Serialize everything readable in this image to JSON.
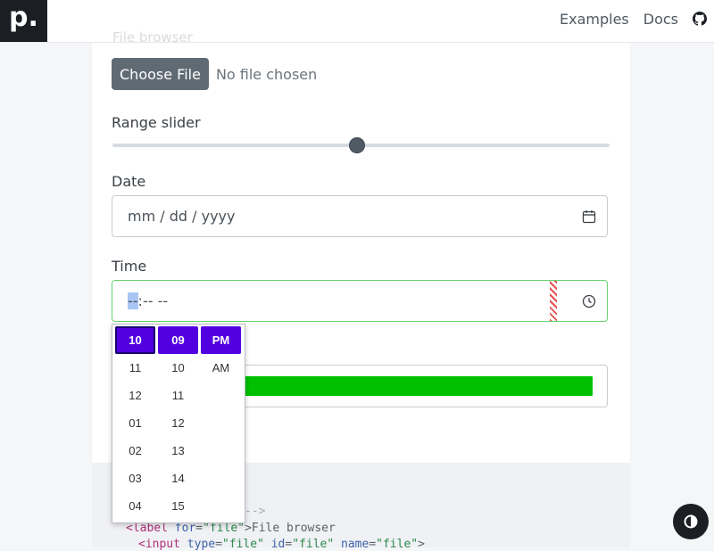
{
  "header": {
    "logo": "p.",
    "nav": [
      "Examples",
      "Docs"
    ]
  },
  "form": {
    "faded_label": "File browser",
    "file": {
      "button": "Choose File",
      "status": "No file chosen"
    },
    "range": {
      "label": "Range slider",
      "value": 0.49
    },
    "date": {
      "label": "Date",
      "placeholder": "mm / dd / yyyy"
    },
    "time": {
      "label": "Time",
      "hour": "--",
      "rest": ":-- --"
    },
    "progress": {
      "value": 1.0
    }
  },
  "picker": {
    "hours": [
      "10",
      "11",
      "12",
      "01",
      "02",
      "03",
      "04"
    ],
    "minutes": [
      "09",
      "10",
      "11",
      "12",
      "13",
      "14",
      "15"
    ],
    "ampm": [
      "PM",
      "AM"
    ]
  },
  "code": {
    "comment": "-->",
    "line2_tag_open": "<label",
    "line2_attr": "for",
    "line2_val": "\"file\"",
    "line2_text": ">File browser",
    "line3_tag_open": "<input",
    "line3_a1": "type",
    "line3_v1": "\"file\"",
    "line3_a2": "id",
    "line3_v2": "\"file\"",
    "line3_a3": "name",
    "line3_v3": "\"file\"",
    "line3_end": ">"
  },
  "colors": {
    "accent": "#5200e0",
    "success": "#00c000",
    "valid_border": "#66d36e"
  },
  "icons": [
    "calendar-icon",
    "clock-icon",
    "github-icon",
    "contrast-icon"
  ]
}
